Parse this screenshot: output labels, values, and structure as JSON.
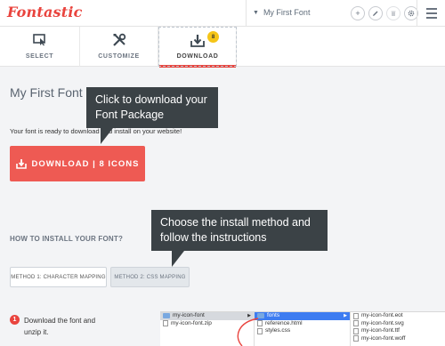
{
  "app": {
    "logo_text": "Fontastic"
  },
  "header": {
    "font_name": "My First Font",
    "actions": [
      {
        "icon": "plus-icon",
        "glyph": "+"
      },
      {
        "icon": "pencil-icon",
        "glyph": "✎"
      },
      {
        "icon": "trash-icon",
        "glyph": "🗑"
      },
      {
        "icon": "gear-icon",
        "glyph": "⚙"
      }
    ]
  },
  "tabs": [
    {
      "label": "SELECT",
      "icon": "select-icon"
    },
    {
      "label": "CUSTOMIZE",
      "icon": "tools-icon"
    },
    {
      "label": "DOWNLOAD",
      "icon": "download-icon",
      "badge": "8",
      "active": true
    }
  ],
  "main": {
    "title": "My First Font",
    "ready_text": "Your font is ready to download and install on your website!",
    "download_label": "DOWNLOAD | 8 ICONS",
    "install_heading": "HOW TO INSTALL YOUR FONT?",
    "methods": [
      "METHOD 1: CHARACTER MAPPING",
      "METHOD 2: CSS MAPPING"
    ],
    "step": {
      "number": "1",
      "text": "Download the font and unzip it."
    }
  },
  "finder": {
    "col1": [
      "my-icon-font",
      "my-icon-font.zip"
    ],
    "col2": [
      "fonts",
      "reference.html",
      "styles.css"
    ],
    "col3": [
      "my-icon-font.eot",
      "my-icon-font.svg",
      "my-icon-font.ttf",
      "my-icon-font.woff"
    ]
  },
  "tooltips": {
    "download": "Click to download your Font Package",
    "install": "Choose the install method and follow the instructions"
  },
  "colors": {
    "accent": "#e9443e",
    "button": "#ee5a53",
    "tooltip": "#3b4246",
    "badge": "#f5c518"
  }
}
